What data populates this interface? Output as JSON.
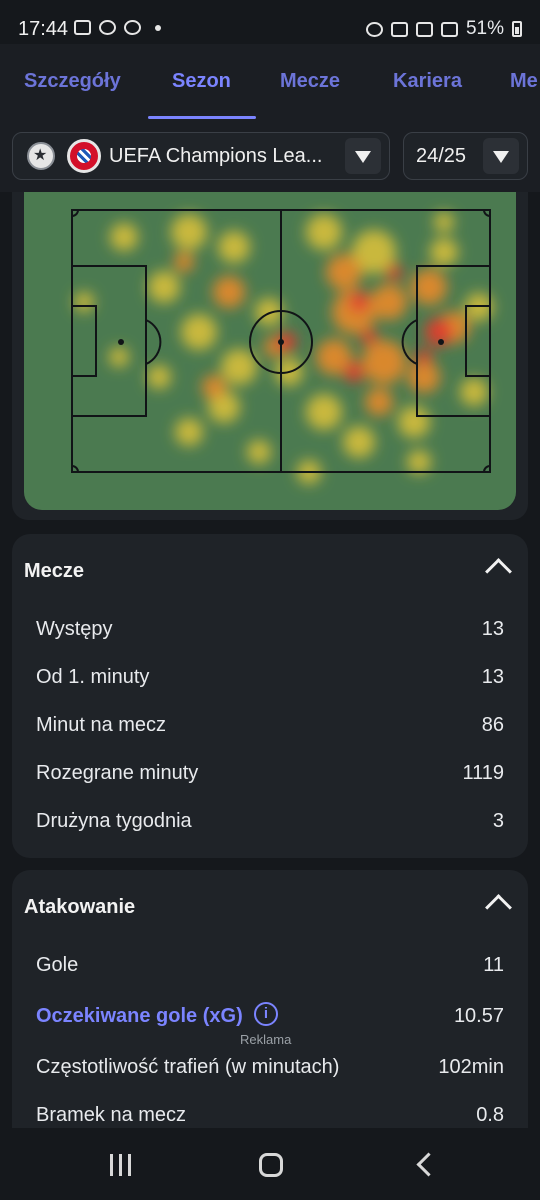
{
  "status": {
    "time": "17:44",
    "battery": "51%"
  },
  "tabs": [
    {
      "label": "Szczegóły"
    },
    {
      "label": "Sezon"
    },
    {
      "label": "Mecze"
    },
    {
      "label": "Kariera"
    },
    {
      "label": "Me"
    }
  ],
  "filters": {
    "competition": "UEFA Champions Lea...",
    "season": "24/25"
  },
  "matches": {
    "title": "Mecze",
    "rows": [
      {
        "label": "Występy",
        "value": "13"
      },
      {
        "label": "Od 1. minuty",
        "value": "13"
      },
      {
        "label": "Minut na mecz",
        "value": "86"
      },
      {
        "label": "Rozegrane minuty",
        "value": "1119"
      },
      {
        "label": "Drużyna tygodnia",
        "value": "3"
      }
    ]
  },
  "attacking": {
    "title": "Atakowanie",
    "rows": [
      {
        "label": "Gole",
        "value": "11"
      },
      {
        "label": "Oczekiwane gole (xG)",
        "value": "10.57"
      },
      {
        "label": "Częstotliwość trafień (w minutach)",
        "value": "102min"
      },
      {
        "label": "Bramek na mecz",
        "value": "0.8"
      }
    ],
    "ad_label": "Reklama"
  },
  "colors": {
    "accent": "#7b84ff",
    "pitch": "#4b7a50",
    "card": "#1f2328",
    "background": "#15181c"
  }
}
